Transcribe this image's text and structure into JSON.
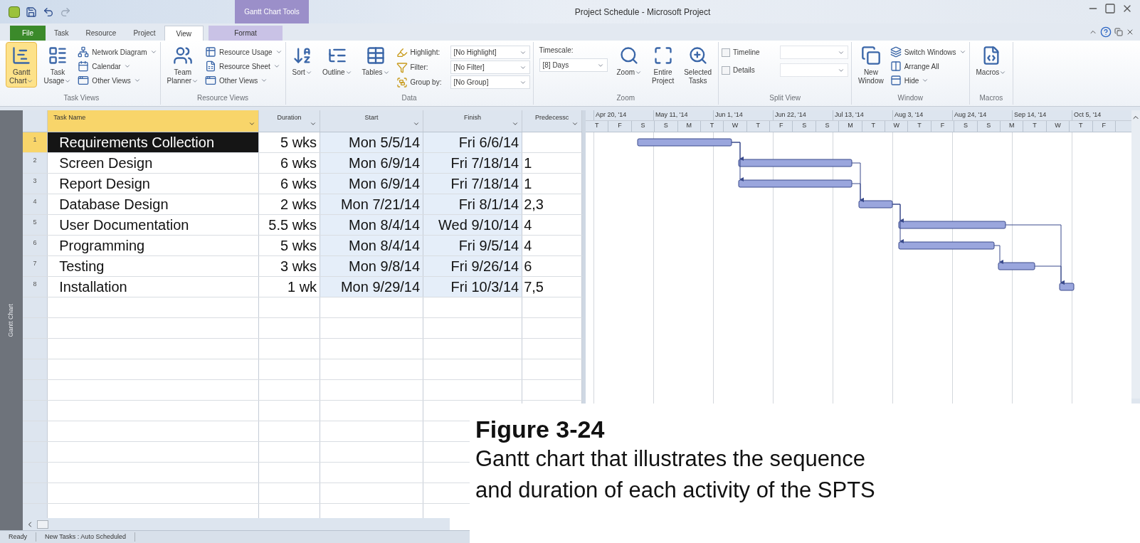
{
  "window": {
    "title": "Project Schedule - Microsoft Project"
  },
  "contextual_tab_group": "Gantt Chart Tools",
  "tabs": [
    {
      "label": "File",
      "kind": "file",
      "selected": false
    },
    {
      "label": "Task",
      "kind": "normal",
      "selected": false
    },
    {
      "label": "Resource",
      "kind": "normal",
      "selected": false
    },
    {
      "label": "Project",
      "kind": "normal",
      "selected": false
    },
    {
      "label": "View",
      "kind": "normal",
      "selected": true
    },
    {
      "label": "Format",
      "kind": "contextual",
      "selected": false
    }
  ],
  "ribbon": {
    "groups": [
      {
        "label": "Task Views",
        "items": [
          {
            "kind": "large",
            "lines": [
              "Gantt",
              "Chart"
            ],
            "dropdown": true,
            "selected": true
          },
          {
            "kind": "large",
            "lines": [
              "Task",
              "Usage"
            ],
            "dropdown": true,
            "selected": false
          },
          {
            "kind": "small",
            "label": "Network Diagram",
            "dropdown": true
          },
          {
            "kind": "small",
            "label": "Calendar",
            "dropdown": true
          },
          {
            "kind": "small",
            "label": "Other Views",
            "dropdown": true
          }
        ]
      },
      {
        "label": "Resource Views",
        "items": [
          {
            "kind": "large",
            "lines": [
              "Team",
              "Planner"
            ],
            "dropdown": true,
            "selected": false
          },
          {
            "kind": "small",
            "label": "Resource Usage",
            "dropdown": true
          },
          {
            "kind": "small",
            "label": "Resource Sheet",
            "dropdown": true
          },
          {
            "kind": "small",
            "label": "Other Views",
            "dropdown": true
          }
        ]
      },
      {
        "label": "Data",
        "items": [
          {
            "kind": "large",
            "lines": [
              "Sort"
            ],
            "dropdown": true,
            "selected": false
          },
          {
            "kind": "large",
            "lines": [
              "Outline"
            ],
            "dropdown": true,
            "selected": false
          },
          {
            "kind": "large",
            "lines": [
              "Tables"
            ],
            "dropdown": true,
            "selected": false
          },
          {
            "kind": "combo",
            "label": "Highlight:",
            "value": "[No Highlight]"
          },
          {
            "kind": "combo",
            "label": "Filter:",
            "value": "[No Filter]"
          },
          {
            "kind": "combo",
            "label": "Group by:",
            "value": "[No Group]"
          }
        ]
      },
      {
        "label": "Zoom",
        "items": [
          {
            "kind": "stacked-combo",
            "label": "Timescale:",
            "value": "[8] Days"
          },
          {
            "kind": "large",
            "lines": [
              "Zoom"
            ],
            "dropdown": true,
            "selected": false
          },
          {
            "kind": "large",
            "lines": [
              "Entire",
              "Project"
            ],
            "dropdown": false,
            "selected": false
          },
          {
            "kind": "large",
            "lines": [
              "Selected",
              "Tasks"
            ],
            "dropdown": false,
            "selected": false
          }
        ]
      },
      {
        "label": "Split View",
        "items": [
          {
            "kind": "check",
            "label": "Timeline",
            "checked": false
          },
          {
            "kind": "check",
            "label": "Details",
            "checked": false
          }
        ]
      },
      {
        "label": "Window",
        "items": [
          {
            "kind": "large",
            "lines": [
              "New",
              "Window"
            ],
            "dropdown": false,
            "selected": false
          },
          {
            "kind": "small",
            "label": "Switch Windows",
            "dropdown": true
          },
          {
            "kind": "small",
            "label": "Arrange All",
            "dropdown": false
          },
          {
            "kind": "small",
            "label": "Hide",
            "dropdown": true
          }
        ]
      },
      {
        "label": "Macros",
        "items": [
          {
            "kind": "large",
            "lines": [
              "Macros"
            ],
            "dropdown": true,
            "selected": false
          }
        ]
      }
    ]
  },
  "side_label": "Gantt Chart",
  "table": {
    "columns": [
      {
        "label": "Task Name",
        "selected": true
      },
      {
        "label": "Duration",
        "selected": false
      },
      {
        "label": "Start",
        "selected": false
      },
      {
        "label": "Finish",
        "selected": false
      },
      {
        "label": "Predecessc",
        "selected": false
      }
    ],
    "rows": [
      {
        "id": "1",
        "name": "Requirements Collection",
        "duration": "5 wks",
        "start": "Mon 5/5/14",
        "finish": "Fri 6/6/14",
        "selected": true
      },
      {
        "id": "2",
        "name": "Screen Design",
        "duration": "6 wks",
        "start": "Mon 6/9/14",
        "finish": "Fri 7/18/14",
        "predecessors": "1",
        "selected": false
      },
      {
        "id": "3",
        "name": "Report Design",
        "duration": "6 wks",
        "start": "Mon 6/9/14",
        "finish": "Fri 7/18/14",
        "predecessors": "1",
        "selected": false
      },
      {
        "id": "4",
        "name": "Database Design",
        "duration": "2 wks",
        "start": "Mon 7/21/14",
        "finish": "Fri 8/1/14",
        "predecessors": "2,3",
        "selected": false
      },
      {
        "id": "5",
        "name": "User Documentation",
        "duration": "5.5 wks",
        "start": "Mon 8/4/14",
        "finish": "Wed 9/10/14",
        "predecessors": "4",
        "selected": false
      },
      {
        "id": "6",
        "name": "Programming",
        "duration": "5 wks",
        "start": "Mon 8/4/14",
        "finish": "Fri 9/5/14",
        "predecessors": "4",
        "selected": false
      },
      {
        "id": "7",
        "name": "Testing",
        "duration": "3 wks",
        "start": "Mon 9/8/14",
        "finish": "Fri 9/26/14",
        "predecessors": "6",
        "selected": false
      },
      {
        "id": "8",
        "name": "Installation",
        "duration": "1 wk",
        "start": "Mon 9/29/14",
        "finish": "Fri 10/3/14",
        "predecessors": "7,5",
        "selected": false
      }
    ]
  },
  "gantt": {
    "major": [
      "Apr 20, '14",
      "May 11, '14",
      "Jun 1, '14",
      "Jun 22, '14",
      "Jul 13, '14",
      "Aug 3, '14",
      "Aug 24, '14",
      "Sep 14, '14",
      "Oct 5, '14"
    ],
    "minor": [
      "T",
      "F",
      "S",
      "S",
      "M",
      "T",
      "W",
      "T",
      "F",
      "S",
      "S",
      "M",
      "T",
      "W",
      "T",
      "F",
      "S",
      "S",
      "M",
      "T",
      "W",
      "T",
      "F"
    ]
  },
  "status_bar": {
    "items": [
      "Ready",
      "New Tasks : Auto Scheduled"
    ]
  },
  "caption": {
    "title": "Figure 3-24",
    "lines": [
      "Gantt chart that illustrates the sequence",
      "and duration of each activity of the SPTS"
    ]
  }
}
